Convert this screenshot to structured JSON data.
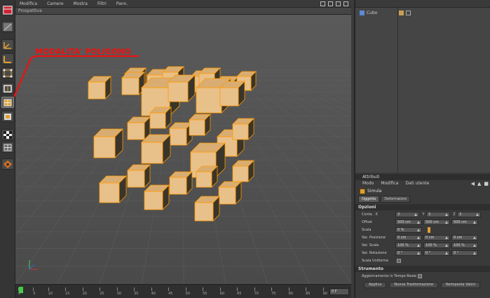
{
  "viewport": {
    "menu": [
      "Modifica",
      "Camere",
      "Mostra",
      "Filtri",
      "Pann."
    ],
    "title": "Prospettiva"
  },
  "annotation": {
    "text": "MODALITA' POLIGONO",
    "color": "#ee1111"
  },
  "timeline": {
    "ticks": [
      "0",
      "5",
      "10",
      "15",
      "20",
      "25",
      "30",
      "35",
      "40",
      "45",
      "50",
      "55",
      "60",
      "65",
      "70",
      "75",
      "80",
      "85",
      "90"
    ],
    "frame": "0 F"
  },
  "object_manager": {
    "object_name": "Cubo"
  },
  "attributes": {
    "title": "Attributi",
    "menu": [
      "Modo",
      "Modifica",
      "Dati utente"
    ],
    "object_name": "Simula",
    "tabs": [
      "Oggetto",
      "Deformatore"
    ],
    "section_options": "Opzioni",
    "rows": [
      {
        "label": "Conta . X",
        "values": [
          "3",
          "3",
          "3"
        ],
        "axes": [
          "X",
          "Y",
          "Z"
        ]
      },
      {
        "label": "Offset",
        "values": [
          "500 cm",
          "500 cm",
          "500 cm"
        ]
      },
      {
        "label": "Scala",
        "values": [
          "0 %"
        ]
      },
      {
        "label": "Var. Posizione",
        "values": [
          "0 cm",
          "0 cm",
          "0 cm"
        ]
      },
      {
        "label": "Var. Scala",
        "values": [
          "100 %",
          "100 %",
          "100 %"
        ]
      },
      {
        "label": "Var. Rotazione",
        "values": [
          "0 °",
          "0 °",
          "0 °"
        ]
      },
      {
        "label": "Scala Uniforme",
        "values": []
      }
    ],
    "section_regen": "Strumento",
    "realtime_label": "Aggiornamento in Tempo Reale",
    "buttons": [
      "Applica",
      "Nuova Trasformazione",
      "Reimposta Valori"
    ]
  },
  "colors": {
    "cube_face": "#e8c08a",
    "cube_side": "#3a352a",
    "cube_edge": "#ff9a00",
    "grid_floor": "#4e4e4e"
  }
}
